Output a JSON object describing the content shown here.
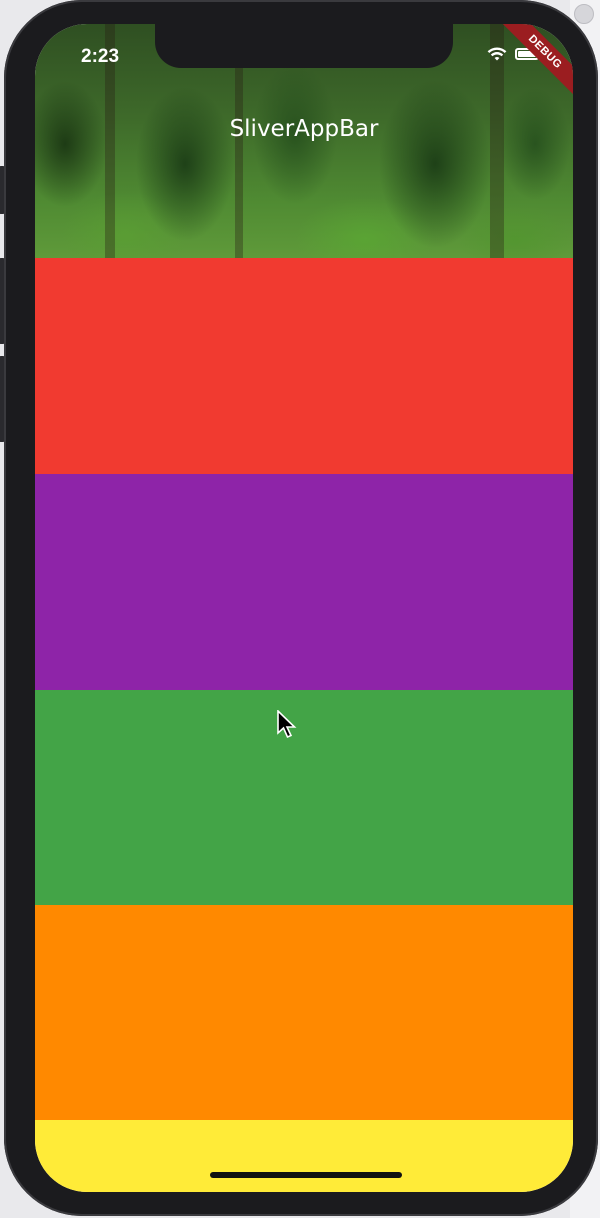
{
  "status_bar": {
    "time": "2:23"
  },
  "app_bar": {
    "title": "SliverAppBar",
    "debug_label": "DEBUG"
  },
  "list": {
    "items": [
      {
        "color": "#f13a30"
      },
      {
        "color": "#8e24a8"
      },
      {
        "color": "#43a447"
      },
      {
        "color": "#ff8900"
      },
      {
        "color": "#ffeb38"
      }
    ]
  },
  "icons": [
    "wifi-icon",
    "battery-icon",
    "mouse-cursor-icon"
  ]
}
